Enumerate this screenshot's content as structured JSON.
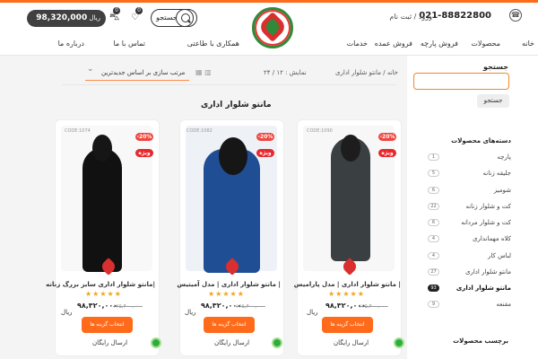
{
  "header": {
    "phone": "021-88822800",
    "login": "ورود / ثبت نام",
    "search_label": "جستجو",
    "cart_price": "98,320,000",
    "currency": "ریال",
    "wishlist_count": "0",
    "cart_count": "0",
    "nav": [
      "خانه",
      "محصولات",
      "فروش پارچه",
      "فروش عمده",
      "خدمات",
      "همکاری با طاعتی",
      "تماس با ما",
      "درباره ما"
    ]
  },
  "sidebar": {
    "search_title": "جستجو",
    "search_button": "جستجو",
    "categories_title": "دسته‌های محصولات",
    "categories": [
      {
        "name": "پارچه",
        "count": "1"
      },
      {
        "name": "جلیقه زنانه",
        "count": "5"
      },
      {
        "name": "شومیز",
        "count": "6"
      },
      {
        "name": "کت و شلوار زنانه",
        "count": "22"
      },
      {
        "name": "کت و شلوار مردانه",
        "count": "6"
      },
      {
        "name": "کلاه مهمانداری",
        "count": "4"
      },
      {
        "name": "لباس کار",
        "count": "4"
      },
      {
        "name": "مانتو شلوار اداری",
        "count": "27"
      },
      {
        "name": "مانتو شلوار اداری",
        "count": "93"
      },
      {
        "name": "مقنعه",
        "count": "9"
      }
    ],
    "brands_title": "برچسب محصولات"
  },
  "toolbar": {
    "breadcrumb": "خانه / مانتو شلوار اداری",
    "show_label": "نمایش : ۱۲ / ۲۴",
    "sort": "مرتب سازی بر اساس جدیدترین"
  },
  "page_title": "مانتو شلوار اداری",
  "products": [
    {
      "code": "CODE:1074",
      "discount": "-20%",
      "special": "ویژه",
      "title": "مانتو شلوار اداری سایز بزرگ زنانه|",
      "old_price": "۱۲۵,۴۰۰,۰۰۰",
      "price": "۹۸,۳۲۰,۰۰۰",
      "currency": "ریال",
      "button": "انتخاب گزینه ها",
      "shipping": "ارسال رایگان",
      "colors": {
        "coat": "#1a1a1a",
        "inner": "#7a7a7a"
      }
    },
    {
      "code": "CODE:1082",
      "discount": "-20%",
      "special": "ویژه",
      "title": "مانتو شلوار اداری | مدل آمیتیس |",
      "old_price": "۱۲۵,۴۰۰,۰۰۰",
      "price": "۹۸,۳۲۰,۰۰۰",
      "currency": "ریال",
      "button": "انتخاب گزینه ها",
      "shipping": "ارسال رایگان",
      "colors": {
        "coat": "#1f4e94",
        "inner": "#767676"
      }
    },
    {
      "code": "CODE:1090",
      "discount": "-20%",
      "special": "ویژه",
      "title": "مانتو شلوار اداری | مدل پارامیس |",
      "old_price": "۱۲۵,۴۰۰,۰۰۰",
      "price": "۹۸,۳۲۰,۰۰۰",
      "currency": "ریال",
      "button": "انتخاب گزینه ها",
      "shipping": "ارسال رایگان",
      "colors": {
        "coat": "#3a3f42",
        "inner": "#777777"
      }
    }
  ],
  "accent": "#ff6b1a"
}
